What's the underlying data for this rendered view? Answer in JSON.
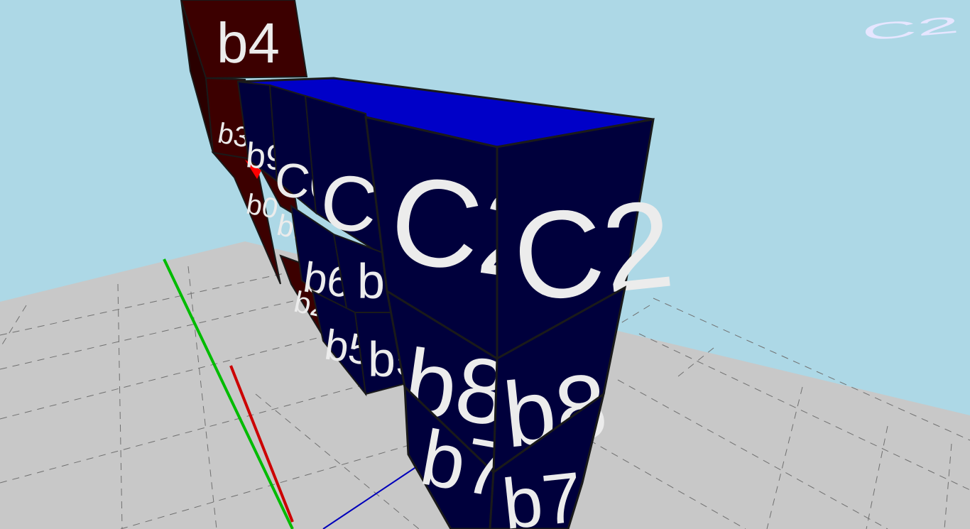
{
  "scene": {
    "colors": {
      "sky": "#add8e6",
      "floor": "#c8c8c8",
      "blue_face_dark": "#00003c",
      "blue_face_top": "#0000c8",
      "red_face": "#3c0000",
      "text": "#ececec"
    },
    "axes": {
      "x_axis_color": "#cc0000",
      "y_axis_color": "#00bb00",
      "z_axis_color": "#0000bb"
    },
    "cubes": {
      "c2": "C2",
      "c1": "C1",
      "c0": "C0",
      "b9": "b9",
      "b8": "b8",
      "b7": "b7",
      "b6": "b6",
      "b5": "b5",
      "b4": "b4",
      "b3": "b3",
      "b2": "b2",
      "b1": "b1",
      "b0": "b0"
    }
  }
}
